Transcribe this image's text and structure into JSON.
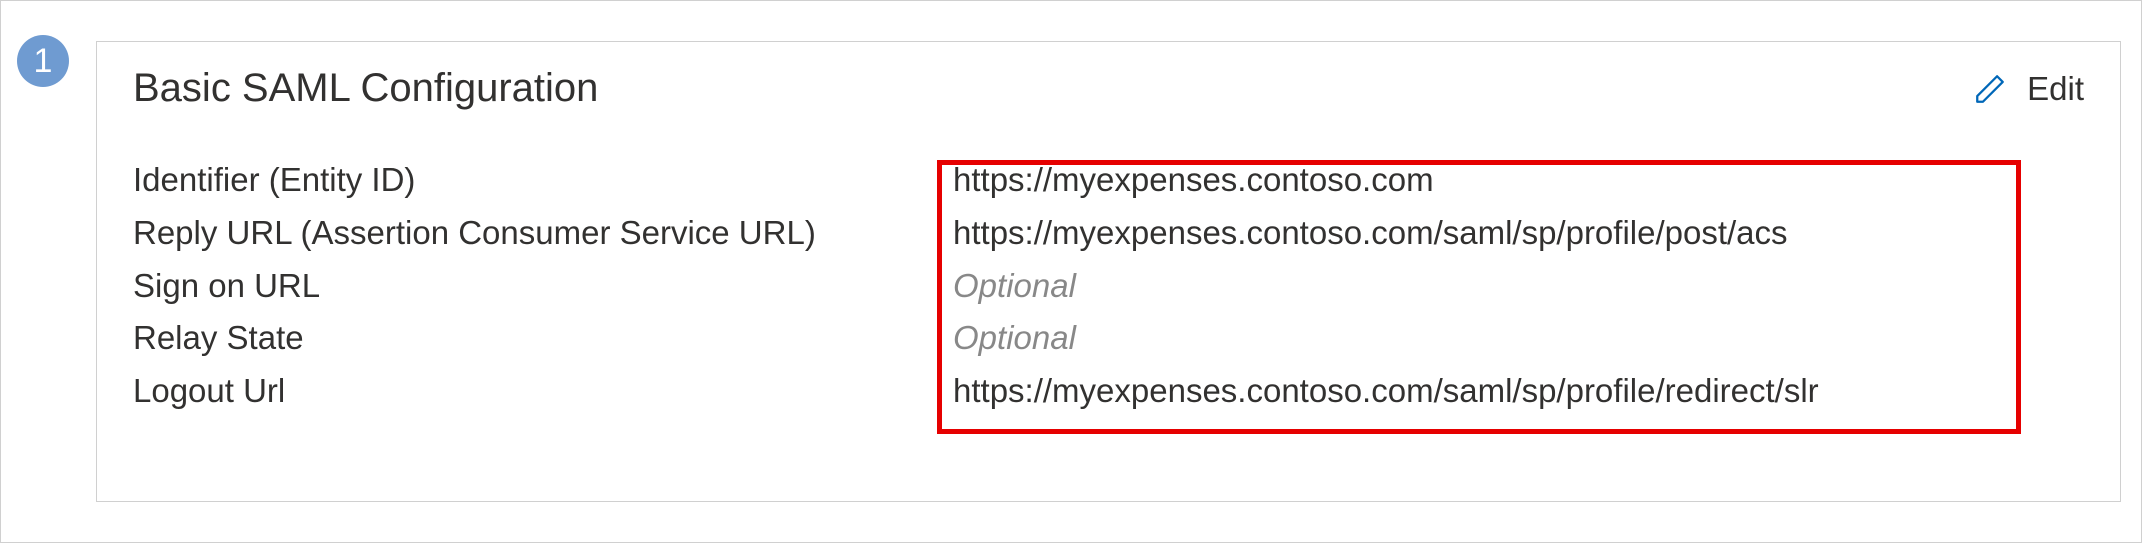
{
  "step": {
    "number": "1"
  },
  "card": {
    "title": "Basic SAML Configuration",
    "edit_label": "Edit"
  },
  "fields": {
    "identifier": {
      "label": "Identifier (Entity ID)",
      "value": "https://myexpenses.contoso.com"
    },
    "reply_url": {
      "label": "Reply URL (Assertion Consumer Service URL)",
      "value": "https://myexpenses.contoso.com/saml/sp/profile/post/acs"
    },
    "sign_on_url": {
      "label": "Sign on URL",
      "value": "Optional"
    },
    "relay_state": {
      "label": "Relay State",
      "value": "Optional"
    },
    "logout_url": {
      "label": "Logout Url",
      "value": "https://myexpenses.contoso.com/saml/sp/profile/redirect/slr"
    }
  }
}
